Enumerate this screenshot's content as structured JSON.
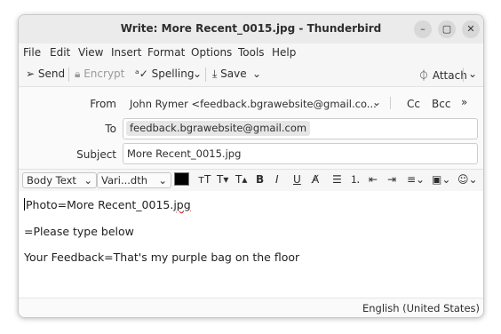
{
  "window": {
    "title": "Write: More Recent_0015.jpg - Thunderbird"
  },
  "window_controls": {
    "minimize": "–",
    "maximize": "▢",
    "close": "✕"
  },
  "menu": [
    "File",
    "Edit",
    "View",
    "Insert",
    "Format",
    "Options",
    "Tools",
    "Help"
  ],
  "toolbar": {
    "send": "Send",
    "encrypt": "Encrypt",
    "spelling": "Spelling",
    "save": "Save",
    "attach": "Attach"
  },
  "header": {
    "from_label": "From",
    "from_value": "John Rymer <feedback.bgrawebsite@gmail.co...",
    "cc": "Cc",
    "bcc": "Bcc",
    "to_label": "To",
    "to_recipient": "feedback.bgrawebsite@gmail.com",
    "subject_label": "Subject",
    "subject_value": "More Recent_0015.jpg"
  },
  "format": {
    "paragraph": "Body Text",
    "font": "Vari...dth"
  },
  "body": {
    "line1_prefix": "Photo=More Recent_0015.",
    "line1_misspelled": "jpg",
    "line2": "=Please type below",
    "line3": "Your Feedback=That's my purple bag on the floor"
  },
  "status": {
    "language": "English (United States)"
  },
  "colors": {
    "text_color_swatch": "#000000"
  }
}
